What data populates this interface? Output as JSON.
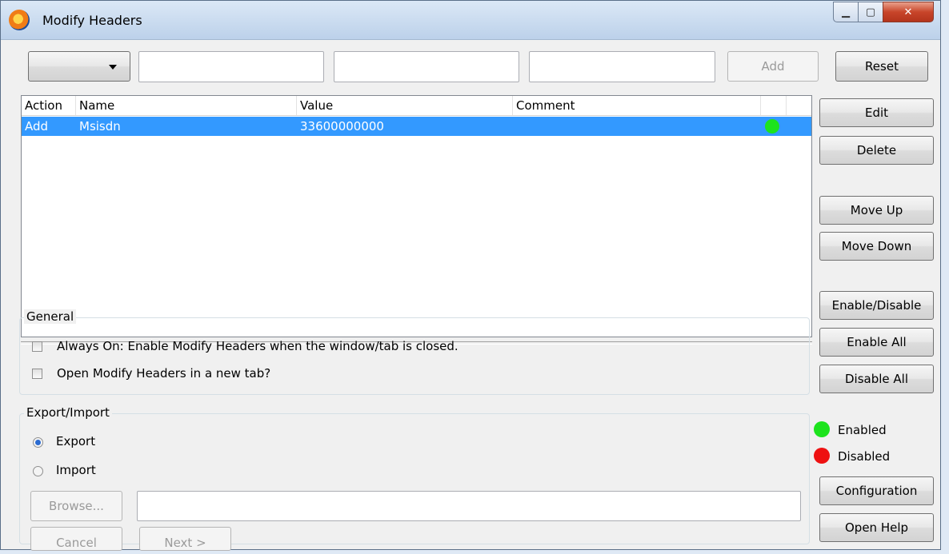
{
  "window": {
    "title": "Modify Headers"
  },
  "toolbar": {
    "action_dropdown_value": "",
    "name_input": "",
    "value_input": "",
    "comment_input": "",
    "add_label": "Add",
    "reset_label": "Reset"
  },
  "table": {
    "columns": [
      "Action",
      "Name",
      "Value",
      "Comment"
    ],
    "rows": [
      {
        "action": "Add",
        "name": "Msisdn",
        "value": "33600000000",
        "comment": "",
        "status": "enabled"
      }
    ]
  },
  "side_buttons": {
    "edit": "Edit",
    "delete": "Delete",
    "move_up": "Move Up",
    "move_down": "Move Down",
    "enable_disable": "Enable/Disable",
    "enable_all": "Enable All",
    "disable_all": "Disable All",
    "configuration": "Configuration",
    "open_help": "Open Help"
  },
  "legend": {
    "enabled": "Enabled",
    "disabled": "Disabled"
  },
  "general": {
    "label": "General",
    "always_on": "Always On: Enable Modify Headers when the window/tab is closed.",
    "new_tab": "Open Modify Headers in a new tab?"
  },
  "export_import": {
    "label": "Export/Import",
    "export": "Export",
    "import": "Import",
    "selected": "Export",
    "browse": "Browse...",
    "path_value": "",
    "cancel": "Cancel",
    "next": "Next >"
  },
  "colors": {
    "enabled": "#1de31d",
    "disabled": "#ee1111",
    "selection": "#3399ff"
  }
}
